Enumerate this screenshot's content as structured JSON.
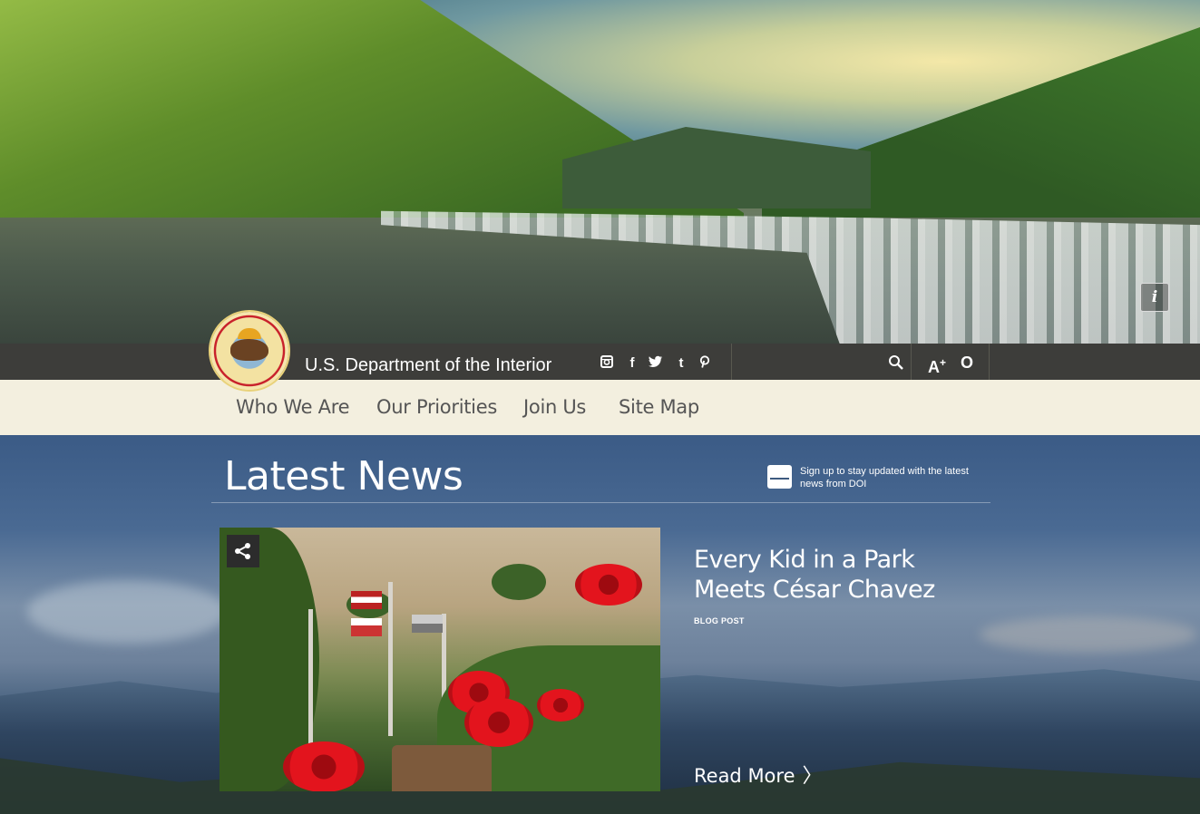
{
  "hero": {
    "info_label": "i"
  },
  "header": {
    "site_title": "U.S. Department of the Interior",
    "social_icons": [
      "instagram-icon",
      "facebook-icon",
      "twitter-icon",
      "tumblr-icon",
      "pinterest-icon"
    ],
    "facebook_glyph": "f",
    "tumblr_glyph": "t",
    "pinterest_glyph": "p",
    "text_size_label": "A",
    "text_size_sup": "+",
    "contrast_glyph": "O"
  },
  "nav": {
    "items": [
      "Who We Are",
      "Our Priorities",
      "Join Us",
      "Site Map"
    ]
  },
  "news": {
    "title": "Latest News",
    "signup_text": "Sign up to stay updated with the latest news from DOI",
    "feature": {
      "title": "Every Kid in a Park Meets César Chavez",
      "type": "BLOG POST",
      "read_more": "Read More"
    }
  },
  "colors": {
    "header_bar": "#3d3d3a",
    "nav_bg": "#f3efdf",
    "nav_text": "#555555"
  }
}
